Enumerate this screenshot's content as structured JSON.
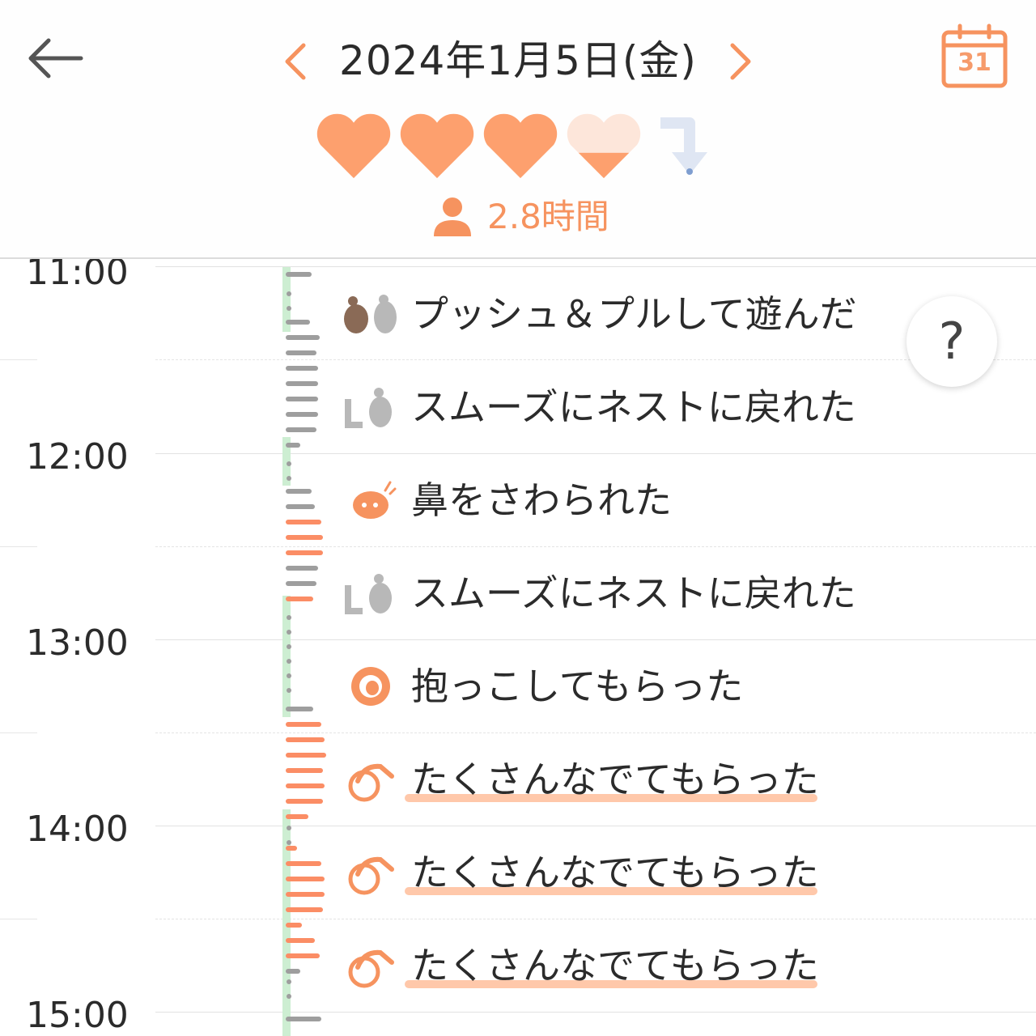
{
  "header": {
    "date_title": "2024年1月5日(金)",
    "calendar_day": "31",
    "duration": "2.8時間"
  },
  "mood": {
    "hearts_full": 3,
    "last_heart_fill": 0.4,
    "trend": "down"
  },
  "help_label": "?",
  "timeline": {
    "hours": [
      "11:00",
      "12:00",
      "13:00",
      "14:00",
      "15:00"
    ]
  },
  "events": [
    {
      "text": "プッシュ＆プルして遊んだ",
      "icon": "hedgehog-pair-icon",
      "highlight": false
    },
    {
      "text": "スムーズにネストに戻れた",
      "icon": "nest-return-icon",
      "highlight": false
    },
    {
      "text": "鼻をさわられた",
      "icon": "nose-touch-icon",
      "highlight": false
    },
    {
      "text": "スムーズにネストに戻れた",
      "icon": "nest-return-icon",
      "highlight": false
    },
    {
      "text": "抱っこしてもらった",
      "icon": "hug-icon",
      "highlight": false
    },
    {
      "text": "たくさんなでてもらった",
      "icon": "petting-icon",
      "highlight": true
    },
    {
      "text": "たくさんなでてもらった",
      "icon": "petting-icon",
      "highlight": true
    },
    {
      "text": "たくさんなでてもらった",
      "icon": "petting-icon",
      "highlight": true
    }
  ],
  "colors": {
    "accent": "#f6935f",
    "heart": "#fda06e",
    "activity_orange": "#fb8d65",
    "activity_gray": "#9e9e9e",
    "track_green": "#cdeed2"
  }
}
